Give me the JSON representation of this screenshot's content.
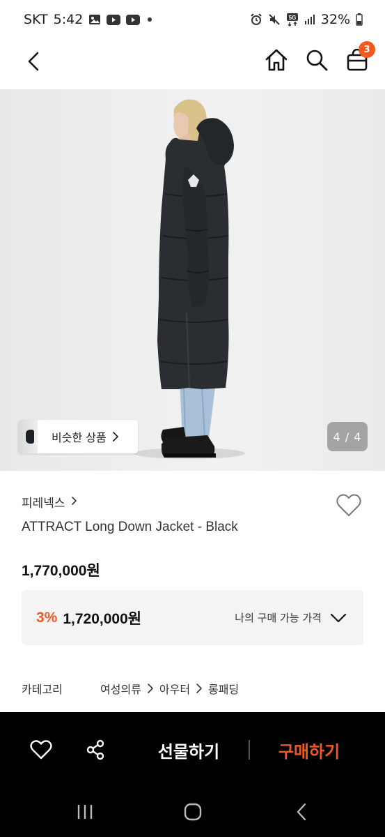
{
  "status_bar": {
    "carrier": "SKT",
    "time": "5:42",
    "network": "5G",
    "battery": "32%",
    "left_icons": [
      "gallery-icon",
      "youtube-icon",
      "youtube-icon",
      "dot-icon"
    ],
    "right_icons": [
      "alarm-icon",
      "mute-icon",
      "5g-icon",
      "signal-icon",
      "battery-icon"
    ]
  },
  "header": {
    "back_icon": "back-arrow-icon",
    "icons": [
      "home-icon",
      "search-icon",
      "cart-icon"
    ],
    "cart_count": "3"
  },
  "gallery": {
    "similar_label": "비슷한 상품",
    "page_indicator": "4 / 4",
    "current_page": 4,
    "total_pages": 4
  },
  "product": {
    "brand": "피레넥스",
    "name": "ATTRACT Long Down Jacket - Black",
    "price": "1,770,000",
    "price_unit": "원"
  },
  "my_price": {
    "discount": "3%",
    "price": "1,720,000",
    "price_unit": "원",
    "label": "나의 구매 가능 가격"
  },
  "category": {
    "title": "카테고리",
    "path": [
      "여성의류",
      "아우터",
      "롱패딩"
    ]
  },
  "action_bar": {
    "gift_label": "선물하기",
    "buy_label": "구매하기"
  },
  "colors": {
    "accent": "#f05a22",
    "bar_bg": "#000000",
    "box_bg": "#f4f4f4"
  }
}
